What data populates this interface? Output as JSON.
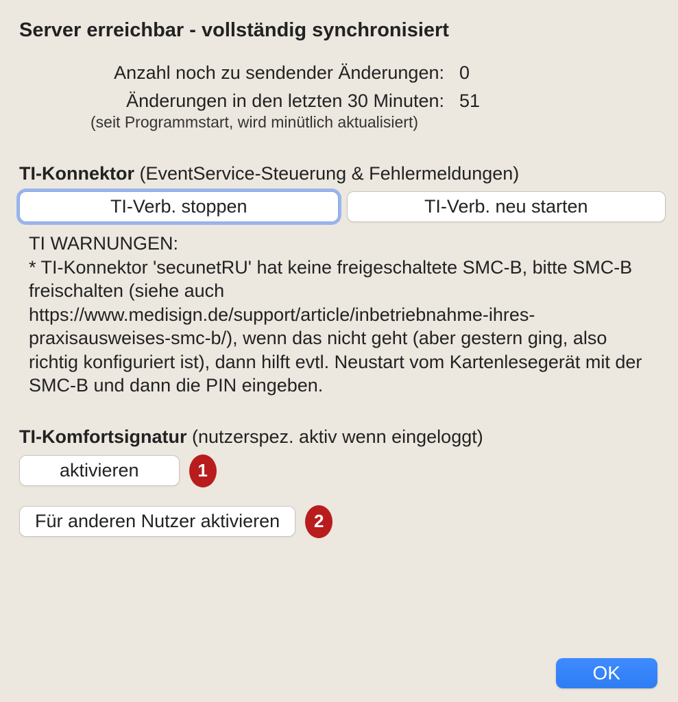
{
  "header": {
    "title": "Server erreichbar - vollständig synchronisiert"
  },
  "stats": {
    "pending_label": "Anzahl noch zu sendender Änderungen:",
    "pending_value": "0",
    "recent_label": "Änderungen in den letzten 30 Minuten:",
    "recent_value": "51",
    "recent_note": "(seit Programmstart, wird minütlich aktualisiert)"
  },
  "connector": {
    "title_bold": "TI-Konnektor",
    "title_paren": "  (EventService-Steuerung & Fehlermeldungen)",
    "stop_label": "TI-Verb. stoppen",
    "restart_label": "TI-Verb. neu starten",
    "warn_heading": "TI WARNUNGEN:",
    "warn_body": " * TI-Konnektor 'secunetRU' hat keine freigeschaltete SMC-B, bitte SMC-B freischalten (siehe auch https://www.medisign.de/support/article/inbetriebnahme-ihres-praxisausweises-smc-b/), wenn das nicht geht (aber gestern ging, also richtig konfiguriert ist), dann hilft evtl. Neustart vom Kartenlesegerät mit der SMC-B und dann die PIN eingeben."
  },
  "signature": {
    "title_bold": "TI-Komfortsignatur",
    "title_paren": "  (nutzerspez. aktiv wenn eingeloggt)",
    "activate_label": "aktivieren",
    "activate_other_label": "Für anderen Nutzer aktivieren",
    "badge1": "1",
    "badge2": "2"
  },
  "footer": {
    "ok_label": "OK"
  }
}
